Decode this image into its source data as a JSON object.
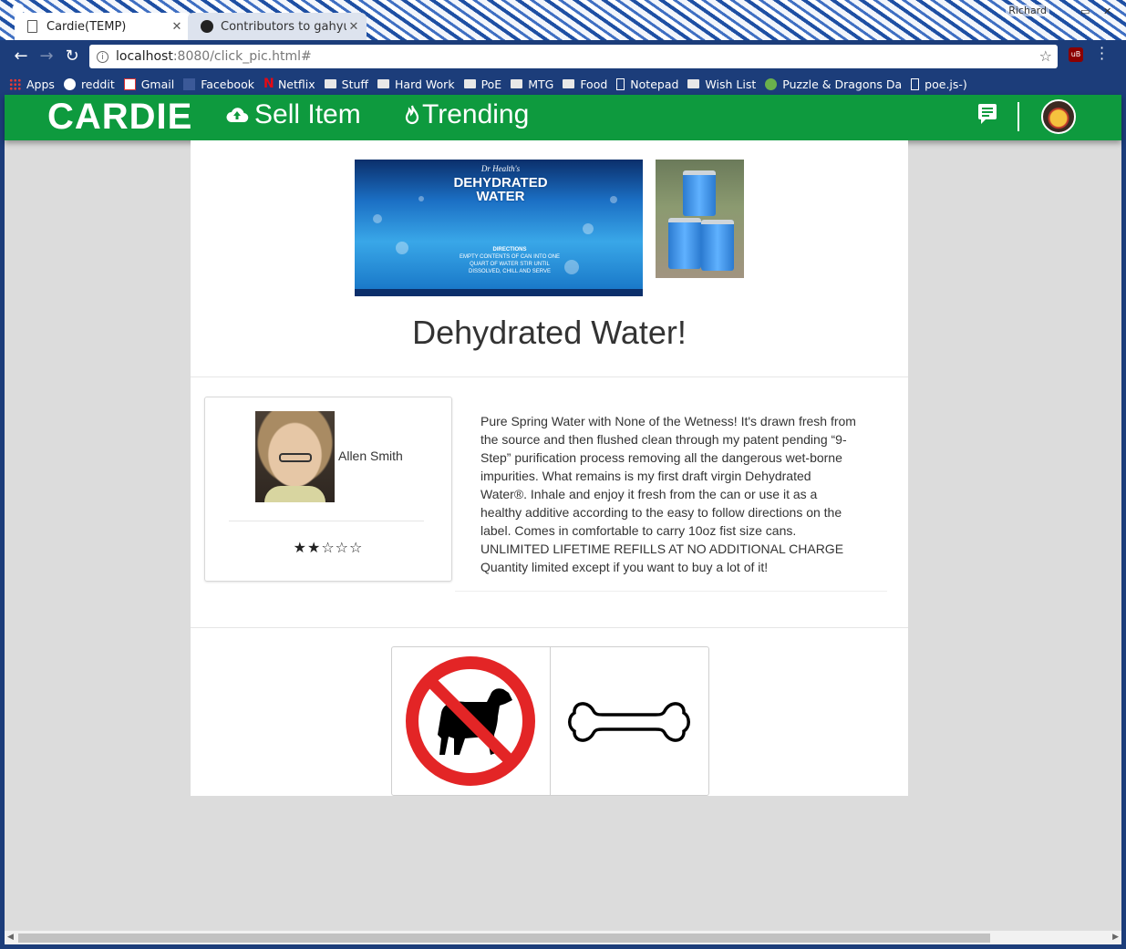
{
  "browser": {
    "profile_name": "Richard",
    "tabs": [
      {
        "label": "Cardie(TEMP)",
        "active": true
      },
      {
        "label": "Contributors to gahyun",
        "active": false
      }
    ],
    "url": {
      "host": "localhost",
      "path": ":8080/click_pic.html#"
    },
    "bookmarks": [
      {
        "label": "Apps",
        "icon": "apps-grid-icon"
      },
      {
        "label": "reddit",
        "icon": "reddit-icon"
      },
      {
        "label": "Gmail",
        "icon": "gmail-icon"
      },
      {
        "label": "Facebook",
        "icon": "facebook-icon"
      },
      {
        "label": "Netflix",
        "icon": "netflix-icon"
      },
      {
        "label": "Stuff",
        "icon": "folder-icon"
      },
      {
        "label": "Hard Work",
        "icon": "folder-icon"
      },
      {
        "label": "PoE",
        "icon": "folder-icon"
      },
      {
        "label": "MTG",
        "icon": "folder-icon"
      },
      {
        "label": "Food",
        "icon": "folder-icon"
      },
      {
        "label": "Notepad",
        "icon": "page-icon"
      },
      {
        "label": "Wish List",
        "icon": "folder-icon"
      },
      {
        "label": "Puzzle & Dragons Da",
        "icon": "puzzle-dragons-icon"
      },
      {
        "label": "poe.js-)",
        "icon": "page-icon"
      }
    ]
  },
  "app": {
    "brand": "CARDIE",
    "nav": {
      "sell_label": "Sell Item",
      "trending_label": "Trending"
    },
    "colors": {
      "nav_bg": "#0e9a3e",
      "page_bg": "#dcdcdc"
    }
  },
  "item": {
    "title": "Dehydrated Water!",
    "image_text": {
      "brand_script": "Dr Health's",
      "product": "DEHYDRATED WATER",
      "directions_title": "DIRECTIONS",
      "directions": "EMPTY CONTENTS OF CAN INTO ONE QUART OF WATER STIR UNTIL DISSOLVED, CHILL AND SERVE"
    },
    "seller": {
      "name": "Allen Smith",
      "rating": "★★☆☆☆",
      "rating_value": 2,
      "rating_max": 5
    },
    "description": "Pure Spring Water with None of the Wetness! It's drawn fresh from the source and then flushed clean through my patent pending “9-Step” purification process removing all the dangerous wet-borne impurities. What remains is my first draft virgin Dehydrated Water®. Inhale and enjoy it fresh from the can or use it as a healthy additive according to the easy to follow directions on the label. Comes in comfortable to carry 10oz fist size cans. UNLIMITED LIFETIME REFILLS AT NO ADDITIONAL CHARGE Quantity limited except if you want to buy a lot of it!"
  },
  "actions": {
    "left_icon": "no-dog-icon",
    "right_icon": "bone-icon"
  }
}
